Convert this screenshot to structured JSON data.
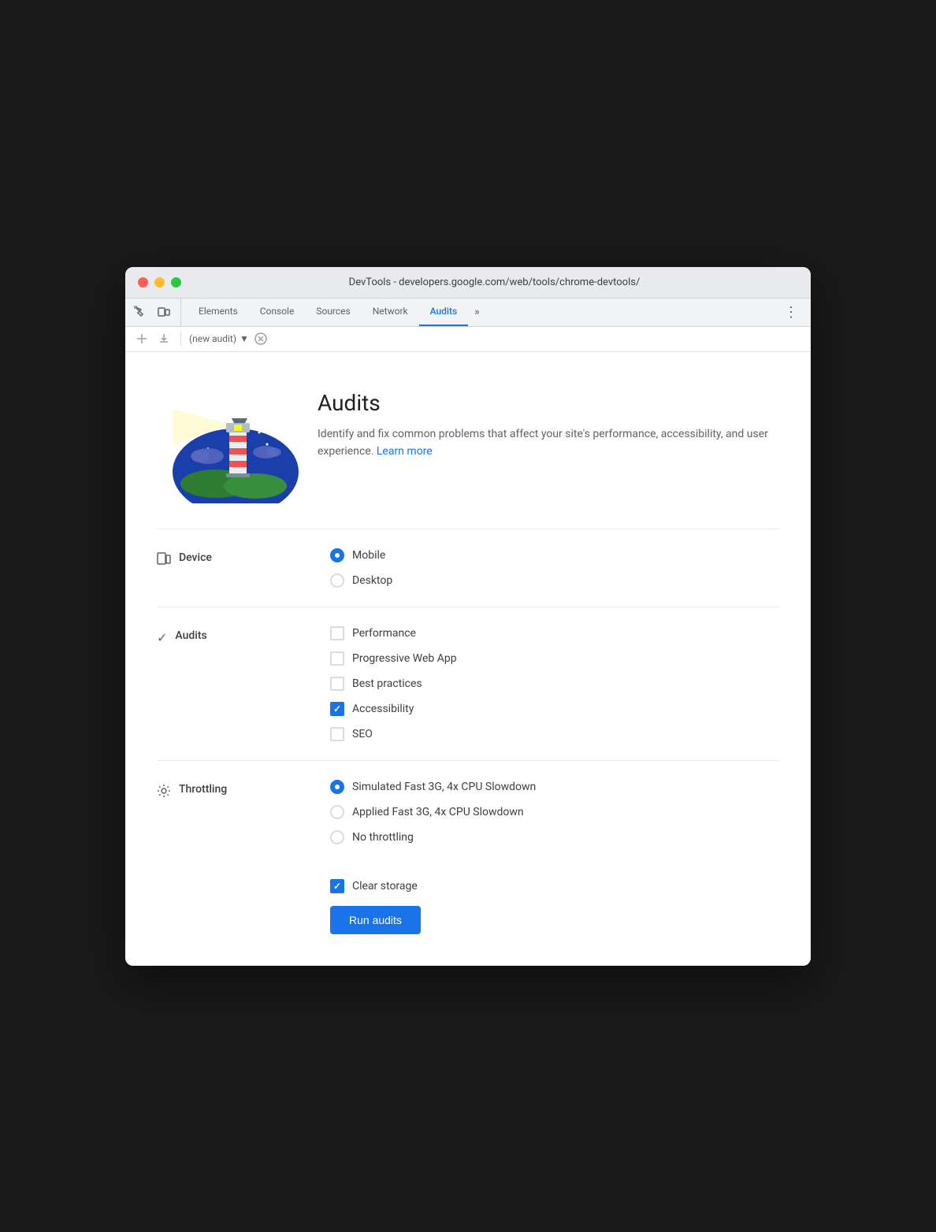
{
  "window": {
    "title": "DevTools - developers.google.com/web/tools/chrome-devtools/"
  },
  "tabs": {
    "items": [
      {
        "id": "elements",
        "label": "Elements",
        "active": false
      },
      {
        "id": "console",
        "label": "Console",
        "active": false
      },
      {
        "id": "sources",
        "label": "Sources",
        "active": false
      },
      {
        "id": "network",
        "label": "Network",
        "active": false
      },
      {
        "id": "audits",
        "label": "Audits",
        "active": true
      }
    ],
    "more_label": "»",
    "menu_label": "⋮"
  },
  "toolbar": {
    "new_audit_placeholder": "(new audit)"
  },
  "header": {
    "title": "Audits",
    "description": "Identify and fix common problems that affect your site's performance, accessibility, and user experience.",
    "learn_more": "Learn more"
  },
  "device_section": {
    "label": "Device",
    "options": [
      {
        "id": "mobile",
        "label": "Mobile",
        "checked": true
      },
      {
        "id": "desktop",
        "label": "Desktop",
        "checked": false
      }
    ]
  },
  "audits_section": {
    "label": "Audits",
    "options": [
      {
        "id": "performance",
        "label": "Performance",
        "checked": false
      },
      {
        "id": "pwa",
        "label": "Progressive Web App",
        "checked": false
      },
      {
        "id": "best-practices",
        "label": "Best practices",
        "checked": false
      },
      {
        "id": "accessibility",
        "label": "Accessibility",
        "checked": true
      },
      {
        "id": "seo",
        "label": "SEO",
        "checked": false
      }
    ]
  },
  "throttling_section": {
    "label": "Throttling",
    "options": [
      {
        "id": "simulated",
        "label": "Simulated Fast 3G, 4x CPU Slowdown",
        "checked": true
      },
      {
        "id": "applied",
        "label": "Applied Fast 3G, 4x CPU Slowdown",
        "checked": false
      },
      {
        "id": "none",
        "label": "No throttling",
        "checked": false
      }
    ]
  },
  "storage_section": {
    "clear_storage": {
      "label": "Clear storage",
      "checked": true
    }
  },
  "run_button": {
    "label": "Run audits"
  }
}
